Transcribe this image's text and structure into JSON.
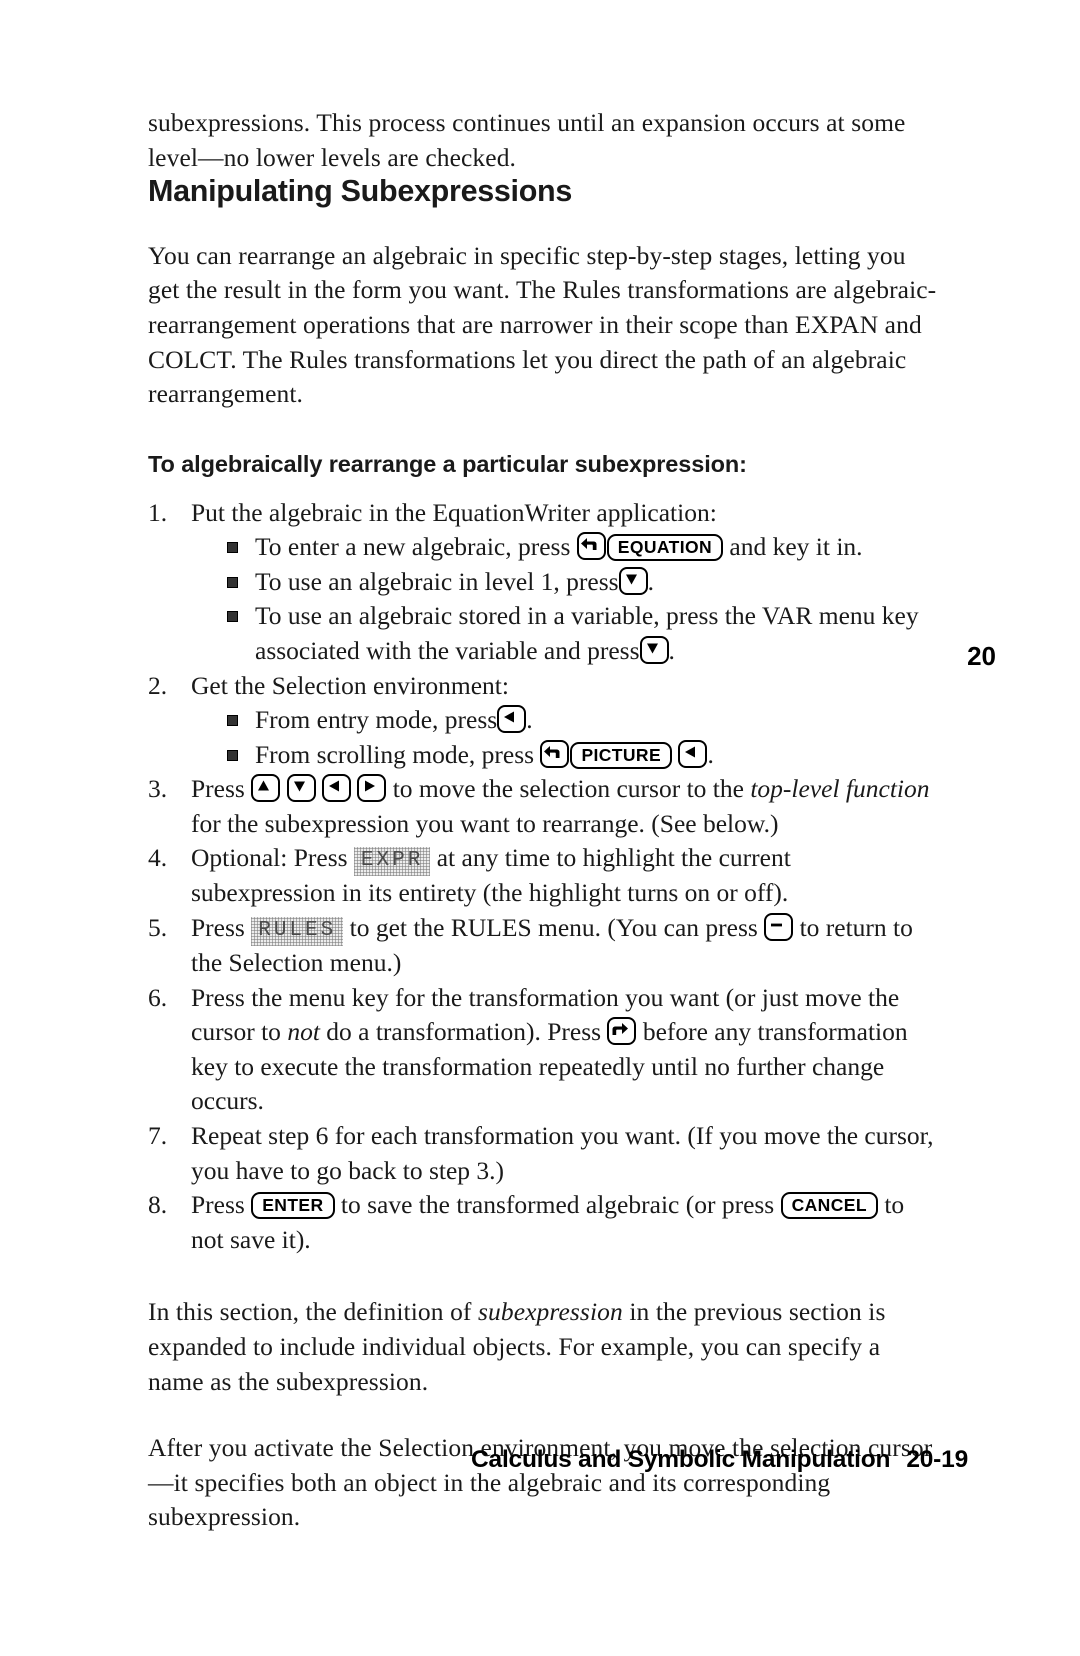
{
  "document": {
    "intro_paragraph": "subexpressions. This process continues until an expansion occurs at some level—no lower levels are checked.",
    "section_heading": "Manipulating Subexpressions",
    "section_paragraph": "You can rearrange an algebraic in specific step-by-step stages, letting you get the result in the form you want. The Rules transformations are algebraic-rearrangement operations that are narrower in their scope than EXPAN and COLCT. The Rules transformations let you direct the path of an algebraic rearrangement.",
    "procedure_heading": "To algebraically rearrange a particular subexpression:",
    "steps": [
      {
        "number": "1.",
        "text": "Put the algebraic in the EquationWriter application:",
        "bullets": [
          {
            "prefix": "To enter a new algebraic, press",
            "key_left_shift": "left-shift-arrow",
            "key_label": "EQUATION",
            "suffix": "and key it in."
          },
          {
            "prefix": "To use an algebraic in level 1, press",
            "key_icon": "down-arrow",
            "suffix": "."
          },
          {
            "prefix": "To use an algebraic stored in a variable, press the VAR menu key associated with the variable and press",
            "key_icon": "down-arrow",
            "suffix": "."
          }
        ]
      },
      {
        "number": "2.",
        "text": "Get the Selection environment:",
        "bullets": [
          {
            "prefix": "From entry mode, press",
            "key_icon": "left-arrow",
            "suffix": "."
          },
          {
            "prefix": "From scrolling mode, press",
            "key_left_shift": "left-shift-arrow",
            "key_label": "PICTURE",
            "key_icon_after": "left-arrow",
            "suffix": "."
          }
        ]
      },
      {
        "number": "3.",
        "text_a": "Press",
        "keys": [
          "up-arrow",
          "down-arrow",
          "left-arrow",
          "right-arrow"
        ],
        "text_b": "to move the selection cursor to the",
        "italic_a": "top-level function",
        "text_c": "for the subexpression you want to rearrange. (See below.)"
      },
      {
        "number": "4.",
        "text_a": "Optional: Press",
        "menu_key": "EXPR",
        "text_b": "at any time to highlight the current subexpression in its entirety (the highlight turns on or off)."
      },
      {
        "number": "5.",
        "text_a": "Press",
        "menu_key": "RULES",
        "text_b": "to get the RULES menu. (You can press",
        "key_icon": "minus-key",
        "text_c": "to return to the Selection menu.)"
      },
      {
        "number": "6.",
        "text_a": "Press the menu key for the transformation you want (or just move the cursor to",
        "italic_a": "not",
        "text_b": "do a transformation). Press",
        "key_icon": "right-shift-arrow",
        "text_c": "before any transformation key to execute the transformation repeatedly until no further change occurs."
      },
      {
        "number": "7.",
        "text": "Repeat step 6 for each transformation you want. (If you move the cursor, you have to go back to step 3.)"
      },
      {
        "number": "8.",
        "text_a": "Press",
        "key_label_a": "ENTER",
        "text_b": "to save the transformed algebraic (or press",
        "key_label_b": "CANCEL",
        "text_c": "to not save it)."
      }
    ],
    "closing_paragraph_1_a": "In this section, the definition of",
    "closing_paragraph_1_italic": "subexpression",
    "closing_paragraph_1_b": "in the previous section is expanded to include individual objects. For example, you can specify a name as the subexpression.",
    "closing_paragraph_2": "After you activate the Selection environment, you move the selection cursor—it specifies both an object in the algebraic and its corresponding subexpression.",
    "margin_tab": "20",
    "footer": {
      "title": "Calculus and Symbolic Manipulation",
      "page_number": "20-19"
    }
  }
}
